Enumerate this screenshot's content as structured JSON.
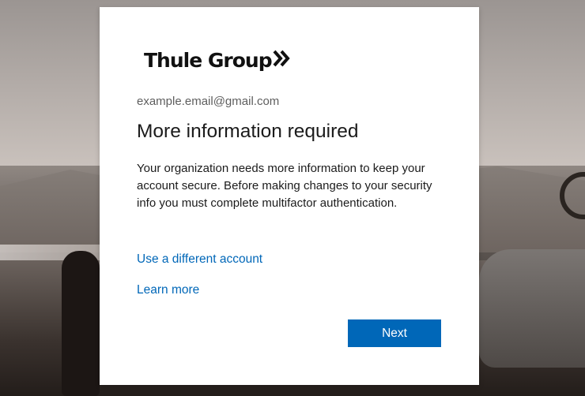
{
  "brand": {
    "name": "Thule Group",
    "logo_icon": "double-chevron-icon"
  },
  "account": {
    "email": "example.email@gmail.com"
  },
  "content": {
    "title": "More information required",
    "description": "Your organization needs more information to keep your account secure. Before making changes to your security info you must complete multifactor authentication."
  },
  "links": {
    "different_account": "Use a different account",
    "learn_more": "Learn more"
  },
  "actions": {
    "next_label": "Next"
  },
  "colors": {
    "accent": "#0067b8",
    "card_background": "#ffffff",
    "text_primary": "#1b1b1b",
    "text_secondary": "#5e5e5e"
  }
}
